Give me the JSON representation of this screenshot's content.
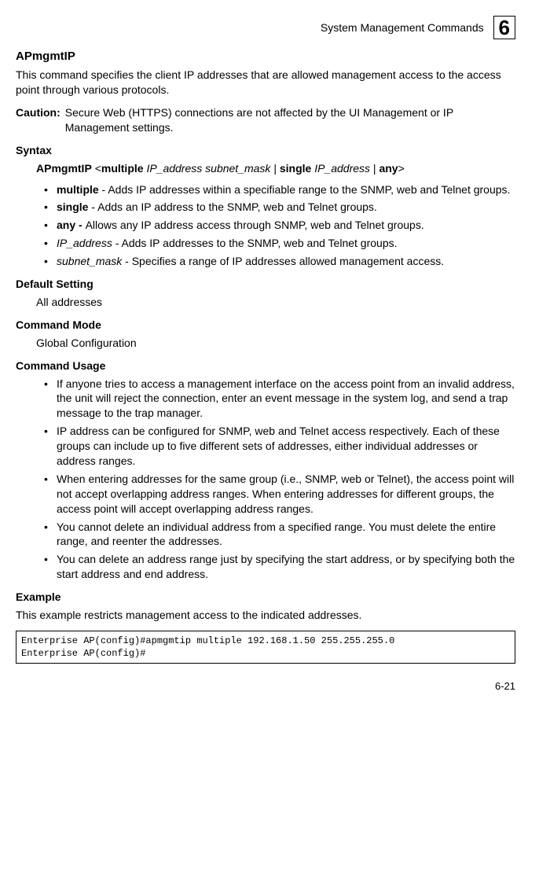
{
  "header": {
    "section_title": "System Management Commands",
    "chapter_number": "6"
  },
  "command": {
    "name": "APmgmtIP",
    "description": "This command specifies the client IP addresses that are allowed management access to the access point through various protocols."
  },
  "caution": {
    "label": "Caution:",
    "text": "Secure Web (HTTPS) connections are not affected by the UI Management or IP Management settings."
  },
  "syntax": {
    "heading": "Syntax",
    "cmd": "APmgmtIP",
    "open": "<",
    "kw_multiple": "multiple",
    "arg_ip": "IP_address",
    "arg_mask": "subnet_mask",
    "pipe1": " | ",
    "kw_single": "single",
    "pipe2": " | ",
    "kw_any": "any",
    "close": ">",
    "params": [
      {
        "name_bold": "multiple",
        "name_ital": "",
        "desc": " - Adds IP addresses within a specifiable range to the SNMP, web and Telnet groups."
      },
      {
        "name_bold": "single",
        "name_ital": "",
        "desc": " - Adds an IP address to the SNMP, web and Telnet groups."
      },
      {
        "name_bold": "any - ",
        "name_ital": "",
        "desc": "Allows any IP address access through SNMP, web and Telnet groups."
      },
      {
        "name_bold": "",
        "name_ital": "IP_address",
        "desc": " - Adds IP addresses to the SNMP, web and Telnet groups."
      },
      {
        "name_bold": "",
        "name_ital": "subnet_mask",
        "desc": " - Specifies a range of IP addresses allowed management access."
      }
    ]
  },
  "default_setting": {
    "heading": "Default Setting",
    "value": "All addresses"
  },
  "command_mode": {
    "heading": "Command Mode",
    "value": "Global Configuration"
  },
  "command_usage": {
    "heading": "Command Usage",
    "items": [
      "If anyone tries to access a management interface on the access point from an invalid address, the unit will reject the connection, enter an event message in the system log, and send a trap message to the trap manager.",
      "IP address can be configured for SNMP, web and Telnet access respectively. Each of these groups can include up to five different sets of addresses, either individual addresses or address ranges.",
      "When entering addresses for the same group (i.e., SNMP, web or Telnet), the access point will not accept overlapping address ranges. When entering addresses for different groups, the access point will accept overlapping address ranges.",
      "You cannot delete an individual address from a specified range. You must delete the entire range, and reenter the addresses.",
      "You can delete an address range just by specifying the start address, or by specifying both the start address and end address."
    ]
  },
  "example": {
    "heading": "Example",
    "intro": "This example restricts management access to the indicated addresses.",
    "code": "Enterprise AP(config)#apmgmtip multiple 192.168.1.50 255.255.255.0\nEnterprise AP(config)#"
  },
  "footer": {
    "page": "6-21"
  }
}
